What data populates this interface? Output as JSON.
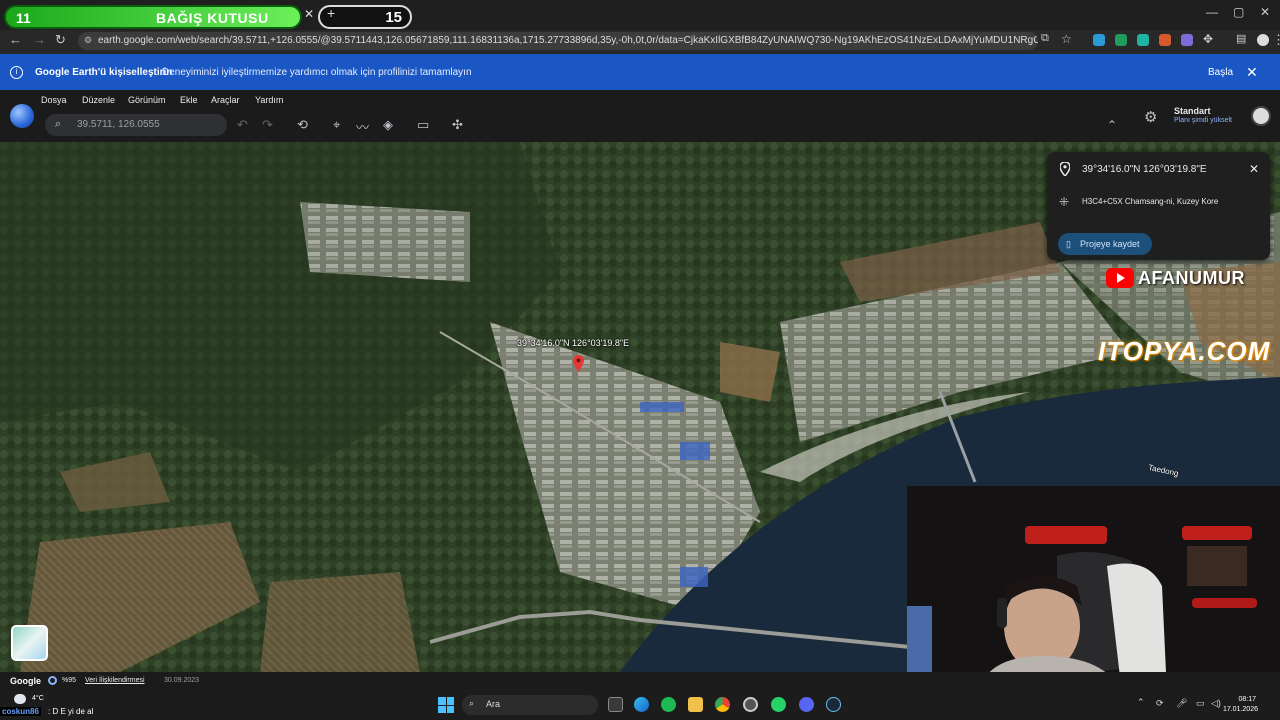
{
  "overlay": {
    "donation_count": "11",
    "donation_label": "BAĞIŞ KUTUSU",
    "counter": "15",
    "youtube_channel": "AFANUMUR",
    "sponsor": "ITOPYA.COM"
  },
  "browser": {
    "url": "earth.google.com/web/search/39.5711,+126.0555/@39.5711443,126.05671859,111.16831136a,1715.27733896d,35y,-0h,0t,0r/data=CjkaKxIlGXBfB84ZyUNAIWQ730-Ng19AKhEzOS41NzExLDAxMjYuMDU1NRgCIAEiJgokCfKIR2_5FERAEeS6vghHl..."
  },
  "notice": {
    "title": "Google Earth'ü kişiselleştirin",
    "text": "Deneyiminizi iyileştirmemize yardımcı olmak için profilinizi tamamlayın",
    "action": "Başla"
  },
  "earth": {
    "menu": [
      "Dosya",
      "Düzenle",
      "Görünüm",
      "Ekle",
      "Araçlar",
      "Yardım"
    ],
    "search_value": "39.5711, 126.0555",
    "plan_name": "Standart",
    "plan_upgrade": "Planı şimdi yükselt"
  },
  "card": {
    "coords": "39°34'16.0\"N 126°03'19.8\"E",
    "plus_code": "H3C4+C5X Chamsang-ni, Kuzey Kore",
    "save_label": "Projeye kaydet"
  },
  "map": {
    "placemark_label": "39°34'16.0\"N 126°03'19.8\"E",
    "river_label": "Taedong"
  },
  "footer": {
    "brand": "Google",
    "progress": "%95",
    "attribution": "Veri İlişkilendirmesi",
    "date": "30.09.2023"
  },
  "taskbar": {
    "temperature": "4°C",
    "chat_user": "coskun86",
    "chat_message": ": D E yi de al",
    "search_placeholder": "Ara",
    "time": "08:17",
    "date": "17.01.2026"
  },
  "colors": {
    "accent_blue": "#1a56c4",
    "donation_green": "#1aa81a",
    "pin_red": "#e53935"
  }
}
